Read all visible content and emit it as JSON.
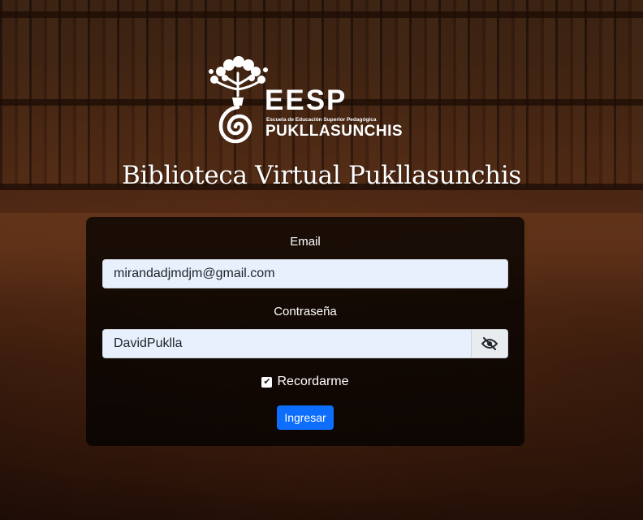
{
  "brand": {
    "acronym": "EESP",
    "subtitle": "Escuela de Educación Superior Pedagógica",
    "name": "PUKLLASUNCHIS"
  },
  "page_title": "Biblioteca Virtual Pukllasunchis",
  "login": {
    "email_label": "Email",
    "email_value": "mirandadjmdjm@gmail.com",
    "password_label": "Contraseña",
    "password_value": "DavidPuklla",
    "toggle_icon": "eye-slash-icon",
    "remember_label": "Recordarme",
    "remember_checked": true,
    "submit_label": "Ingresar"
  },
  "colors": {
    "primary_button": "#0d6efd",
    "input_autofill": "#e8f0fe",
    "card_overlay": "rgba(0,0,0,0.74)"
  }
}
